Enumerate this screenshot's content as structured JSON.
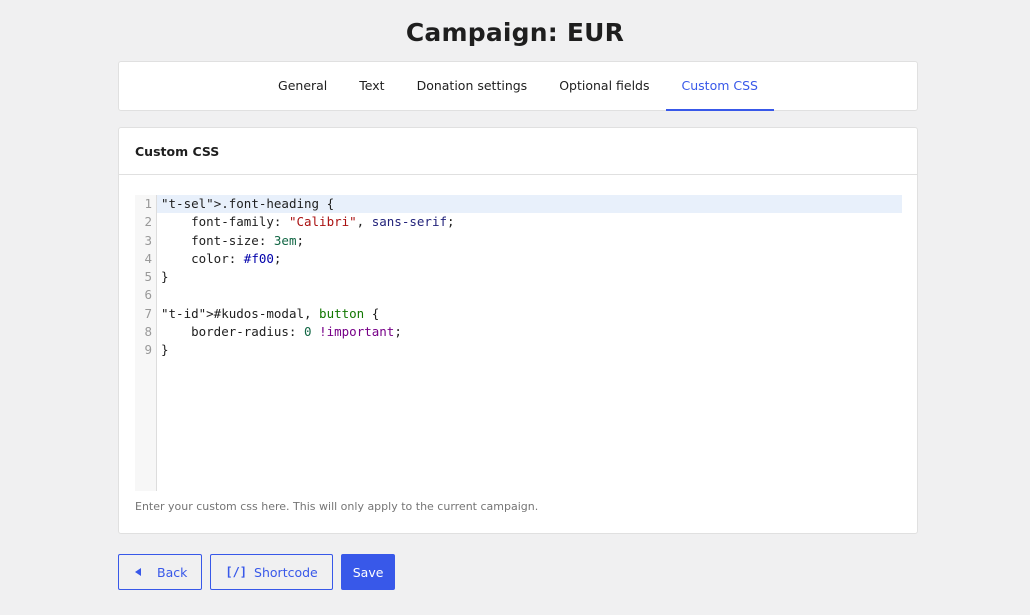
{
  "page": {
    "title": "Campaign: EUR"
  },
  "tabs": [
    {
      "label": "General"
    },
    {
      "label": "Text"
    },
    {
      "label": "Donation settings"
    },
    {
      "label": "Optional fields"
    },
    {
      "label": "Custom CSS",
      "active": true
    }
  ],
  "panel": {
    "title": "Custom CSS",
    "help": "Enter your custom css here. This will only apply to the current campaign."
  },
  "editor": {
    "line_numbers": [
      "1",
      "2",
      "3",
      "4",
      "5",
      "6",
      "7",
      "8",
      "9"
    ],
    "lines": [
      ".font-heading {",
      "    font-family: \"Calibri\", sans-serif;",
      "    font-size: 3em;",
      "    color: #f00;",
      "}",
      "",
      "#kudos-modal, button {",
      "    border-radius: 0 !important;",
      "}"
    ]
  },
  "actions": {
    "back_label": "Back",
    "shortcode_icon": "[/]",
    "shortcode_label": "Shortcode",
    "save_label": "Save"
  },
  "colors": {
    "accent": "#3858e9",
    "background": "#f0f0f1"
  }
}
